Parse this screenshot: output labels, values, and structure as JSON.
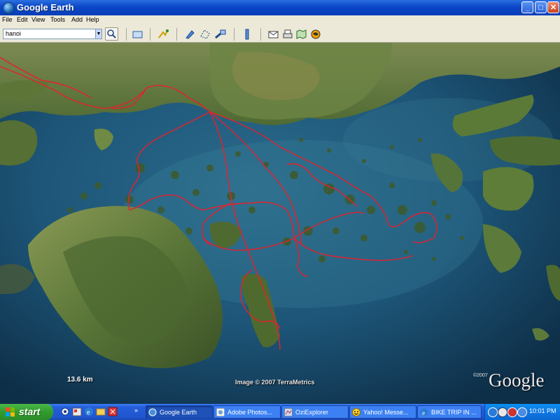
{
  "window": {
    "title": "Google Earth"
  },
  "menu": [
    "File",
    "Edit",
    "View",
    "Tools",
    "Add",
    "Help"
  ],
  "search": {
    "value": "hanoi"
  },
  "map": {
    "scale_label": "13.6 km",
    "copyright": "Image © 2007 TerraMetrics",
    "google_year": "©2007",
    "google_logo": "Google"
  },
  "taskbar": {
    "start_label": "start",
    "tasks": [
      {
        "label": "Google Earth",
        "icon": "google-earth-icon",
        "active": true
      },
      {
        "label": "Adobe Photos...",
        "icon": "photoshop-icon",
        "active": false
      },
      {
        "label": "OziExplorer",
        "icon": "oziexplorer-icon",
        "active": false
      },
      {
        "label": "Yahoo! Messe...",
        "icon": "yahoo-messenger-icon",
        "active": false
      },
      {
        "label": "BIKE TRIP IN ...",
        "icon": "internet-explorer-icon",
        "active": false
      }
    ],
    "clock": "10:01 PM"
  },
  "colors": {
    "route": "#e8202a",
    "sea": "#1d5a7e",
    "land": "#5f7a3a",
    "taskbar": "#245edb"
  }
}
